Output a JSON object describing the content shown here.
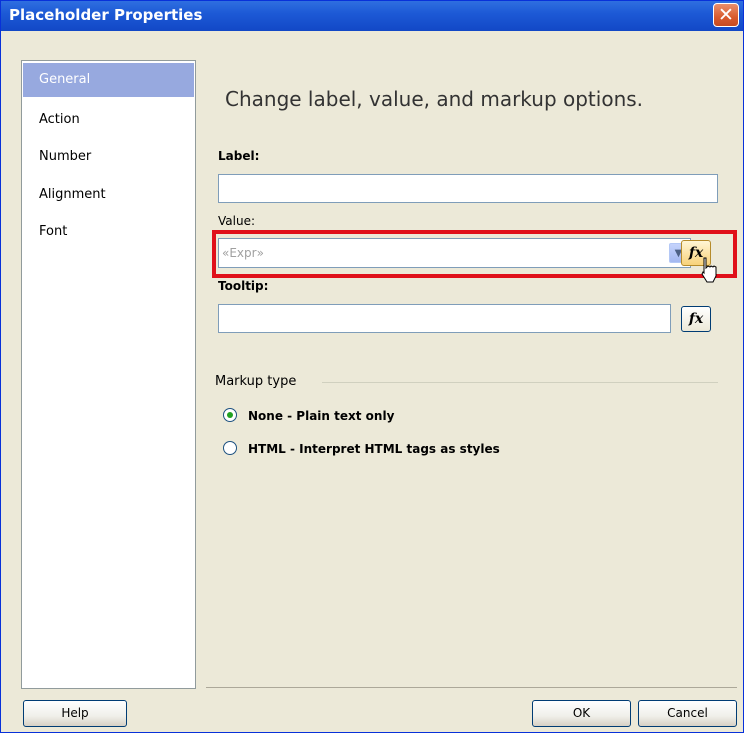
{
  "window": {
    "title": "Placeholder Properties"
  },
  "sidebar": {
    "items": [
      {
        "label": "General"
      },
      {
        "label": "Action"
      },
      {
        "label": "Number"
      },
      {
        "label": "Alignment"
      },
      {
        "label": "Font"
      }
    ]
  },
  "main": {
    "heading": "Change label, value, and markup options.",
    "label_field": {
      "label": "Label:",
      "value": ""
    },
    "value_field": {
      "label": "Value:",
      "value": "«Expr»"
    },
    "tooltip_field": {
      "label": "Tooltip:",
      "value": ""
    },
    "fx_button": "fx",
    "markup_type": {
      "label": "Markup type",
      "options": [
        {
          "label": "None - Plain text only",
          "selected": true
        },
        {
          "label": "HTML - Interpret HTML tags as styles",
          "selected": false
        }
      ]
    }
  },
  "footer": {
    "help": "Help",
    "ok": "OK",
    "cancel": "Cancel"
  },
  "colors": {
    "accent": "#97a9df",
    "highlight": "#e0101a",
    "titlebar": "#1d5ad6"
  },
  "icons": [
    "close-icon",
    "expression-fx-icon",
    "dropdown-arrow-icon",
    "mouse-cursor-icon"
  ]
}
